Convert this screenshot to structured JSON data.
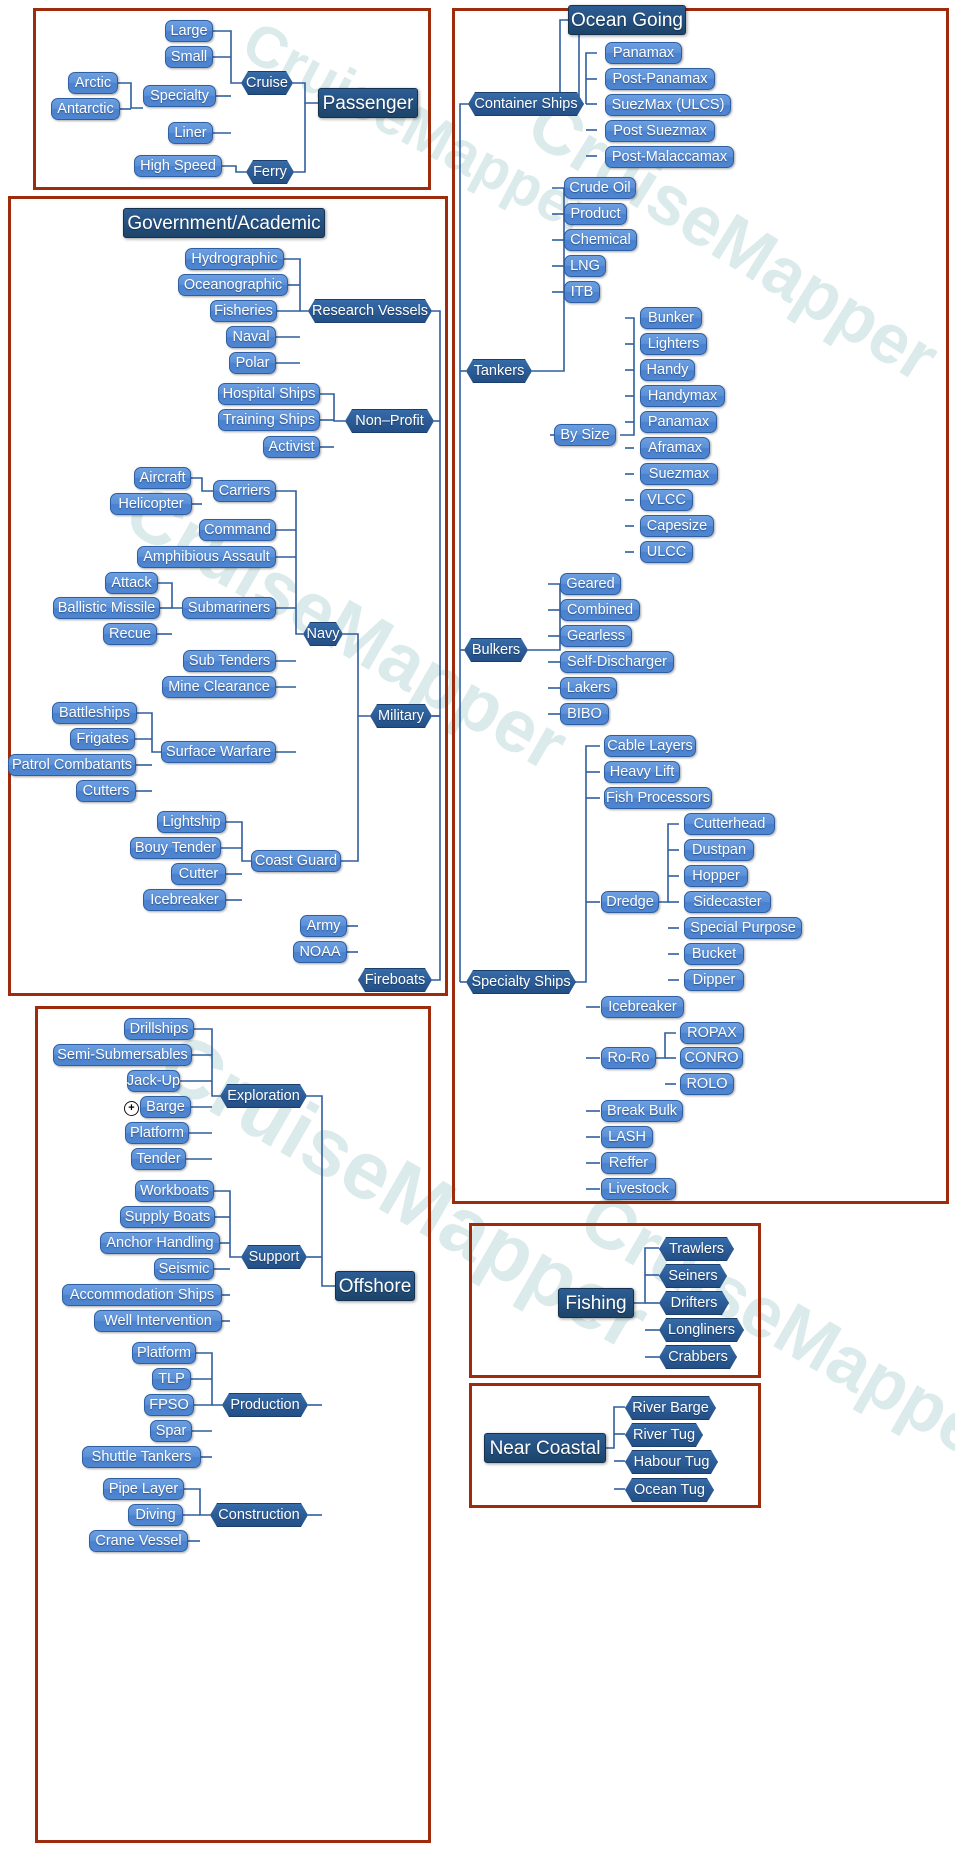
{
  "diagram": {
    "title": "Ship Types Classification Mind Map",
    "watermark_text": "CruiseMapper",
    "group_border_color": "#9e2b0b",
    "leaf_color": "#5a90d8",
    "mid_color": "#2c5c97",
    "root_color": "#24507f",
    "expand_icon": "plus-icon"
  },
  "groups": [
    {
      "id": "passenger",
      "root": "Passenger"
    },
    {
      "id": "government",
      "root": "Government/Academic"
    },
    {
      "id": "offshore",
      "root": "Offshore"
    },
    {
      "id": "ocean",
      "root": "Ocean Going"
    },
    {
      "id": "fishing",
      "root": "Fishing"
    },
    {
      "id": "coastal",
      "root": "Near Coastal"
    }
  ],
  "nodes": {
    "passenger": {
      "root": "Passenger",
      "cruise": "Cruise",
      "ferry": "Ferry",
      "large": "Large",
      "small": "Small",
      "specialty": "Specialty",
      "liner": "Liner",
      "arctic": "Arctic",
      "antarctic": "Antarctic",
      "high_speed": "High Speed"
    },
    "government": {
      "root": "Government/Academic",
      "research_vessels": "Research Vessels",
      "hydrographic": "Hydrographic",
      "oceanographic": "Oceanographic",
      "fisheries": "Fisheries",
      "naval": "Naval",
      "polar": "Polar",
      "non_profit": "Non–Profit",
      "hospital_ships": "Hospital Ships",
      "training_ships": "Training Ships",
      "activist": "Activist",
      "military": "Military",
      "navy": "Navy",
      "carriers": "Carriers",
      "aircraft": "Aircraft",
      "helicopter": "Helicopter",
      "command": "Command",
      "amphibious_assault": "Amphibious Assault",
      "submariners": "Submariners",
      "attack": "Attack",
      "ballistic_missile": "Ballistic Missile",
      "recue": "Recue",
      "sub_tenders": "Sub Tenders",
      "mine_clearance": "Mine Clearance",
      "surface_warfare": "Surface Warfare",
      "battleships": "Battleships",
      "frigates": "Frigates",
      "patrol_combatants": "Patrol Combatants",
      "cutters": "Cutters",
      "coast_guard": "Coast Guard",
      "lightship": "Lightship",
      "bouy_tender": "Bouy Tender",
      "cutter": "Cutter",
      "icebreaker": "Icebreaker",
      "army": "Army",
      "noaa": "NOAA",
      "fireboats": "Fireboats"
    },
    "offshore": {
      "root": "Offshore",
      "exploration": "Exploration",
      "drillships": "Drillships",
      "semi_submersables": "Semi-Submersables",
      "jack_up": "Jack-Up",
      "barge": "Barge",
      "platform_e": "Platform",
      "tender": "Tender",
      "support": "Support",
      "workboats": "Workboats",
      "supply_boats": "Supply Boats",
      "anchor_handling": "Anchor Handling",
      "seismic": "Seismic",
      "accommodation_ships": "Accommodation Ships",
      "well_intervention": "Well Intervention",
      "production": "Production",
      "platform_p": "Platform",
      "tlp": "TLP",
      "fpso": "FPSO",
      "spar": "Spar",
      "shuttle_tankers": "Shuttle Tankers",
      "construction": "Construction",
      "pipe_layer": "Pipe Layer",
      "diving": "Diving",
      "crane_vessel": "Crane Vessel"
    },
    "ocean": {
      "root": "Ocean Going",
      "container_ships": "Container Ships",
      "panamax_c": "Panamax",
      "post_panamax": "Post-Panamax",
      "suezmax_ulcs": "SuezMax (ULCS)",
      "post_suezmax": "Post Suezmax",
      "post_malaccamax": "Post-Malaccamax",
      "tankers": "Tankers",
      "crude_oil": "Crude Oil",
      "product": "Product",
      "chemical": "Chemical",
      "lng": "LNG",
      "itb": "ITB",
      "by_size": "By Size",
      "bunker": "Bunker",
      "lighters": "Lighters",
      "handy": "Handy",
      "handymax": "Handymax",
      "panamax_t": "Panamax",
      "aframax": "Aframax",
      "suezmax_t": "Suezmax",
      "vlcc": "VLCC",
      "capesize": "Capesize",
      "ulcc": "ULCC",
      "bulkers": "Bulkers",
      "geared": "Geared",
      "combined": "Combined",
      "gearless": "Gearless",
      "self_discharger": "Self-Discharger",
      "lakers": "Lakers",
      "bibo": "BIBO",
      "specialty_ships": "Specialty Ships",
      "cable_layers": "Cable Layers",
      "heavy_lift": "Heavy Lift",
      "fish_processors": "Fish Processors",
      "dredge": "Dredge",
      "cutterhead": "Cutterhead",
      "dustpan": "Dustpan",
      "hopper": "Hopper",
      "sidecaster": "Sidecaster",
      "special_purpose": "Special Purpose",
      "bucket": "Bucket",
      "dipper": "Dipper",
      "icebreaker_o": "Icebreaker",
      "ro_ro": "Ro-Ro",
      "ropax": "ROPAX",
      "conro": "CONRO",
      "rolo": "ROLO",
      "break_bulk": "Break Bulk",
      "lash": "LASH",
      "reffer": "Reffer",
      "livestock": "Livestock"
    },
    "fishing": {
      "root": "Fishing",
      "trawlers": "Trawlers",
      "seiners": "Seiners",
      "drifters": "Drifters",
      "longliners": "Longliners",
      "crabbers": "Crabbers"
    },
    "coastal": {
      "root": "Near Coastal",
      "river_barge": "River Barge",
      "river_tug": "River Tug",
      "habour_tug": "Habour Tug",
      "ocean_tug": "Ocean Tug"
    }
  }
}
